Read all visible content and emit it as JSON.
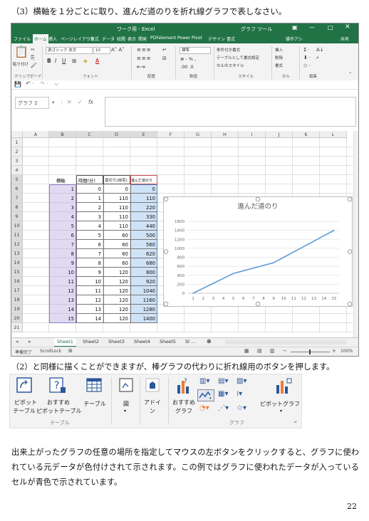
{
  "heading": "（3）横軸を１分ごとに取り、進んだ道のりを折れ線グラフで表しなさい。",
  "excel": {
    "title": "ワーク用 - Excel",
    "chart_tools": "グラフ ツール",
    "tabs": [
      "ファイル",
      "ホーム",
      "挿入",
      "ページレイアウト",
      "数式",
      "データ",
      "校閲",
      "表示",
      "開発",
      "PDFelement",
      "Power Pivot",
      "デザイン",
      "書式"
    ],
    "active_tab": "ホーム",
    "tell_me": "操作アシ",
    "share": "共有",
    "ribbon": {
      "paste": "貼り付け",
      "font_name": "游ゴシック 本文",
      "font_size": "10",
      "number_format": "標準",
      "cond_format": "条件付き書式",
      "table_format": "テーブルとして書式設定",
      "cell_styles": "セルのスタイル",
      "insert": "挿入",
      "delete": "削除",
      "format": "書式",
      "groups": [
        "クリップボード",
        "フォント",
        "配置",
        "数値",
        "スタイル",
        "セル",
        "編集"
      ]
    },
    "name_box": "グラフ 2",
    "fx": "fx",
    "columns": [
      "A",
      "B",
      "C",
      "D",
      "E",
      "F",
      "G",
      "H",
      "I",
      "J",
      "K",
      "L"
    ],
    "rows": [
      "1",
      "2",
      "3",
      "4",
      "5",
      "6",
      "7",
      "8",
      "9",
      "10",
      "11",
      "12",
      "13",
      "14",
      "15",
      "16",
      "17",
      "18",
      "19",
      "20",
      "21"
    ],
    "table_headers": [
      "横軸",
      "時間(分)",
      "道のり(自宅)",
      "進んだ道のり"
    ],
    "table": [
      [
        1,
        0,
        0,
        0
      ],
      [
        2,
        1,
        110,
        110
      ],
      [
        3,
        2,
        110,
        220
      ],
      [
        4,
        3,
        110,
        330
      ],
      [
        5,
        4,
        110,
        440
      ],
      [
        6,
        5,
        60,
        500
      ],
      [
        7,
        6,
        60,
        560
      ],
      [
        8,
        7,
        60,
        620
      ],
      [
        9,
        8,
        60,
        680
      ],
      [
        10,
        9,
        120,
        800
      ],
      [
        11,
        10,
        120,
        920
      ],
      [
        12,
        11,
        120,
        1040
      ],
      [
        13,
        12,
        120,
        1160
      ],
      [
        14,
        13,
        120,
        1280
      ],
      [
        15,
        14,
        120,
        1400
      ]
    ],
    "sheet_tabs": [
      "Sheet1",
      "Sheet2",
      "Sheet3",
      "Sheet4",
      "Sheet5",
      "Sl ..."
    ],
    "active_sheet": "Sheet1",
    "status_left": "準備完了",
    "scroll_lock": "ScrollLock",
    "zoom": "100%"
  },
  "chart_data": {
    "type": "line",
    "title": "進んだ道のり",
    "categories": [
      "1",
      "2",
      "3",
      "4",
      "5",
      "6",
      "7",
      "8",
      "9",
      "10",
      "11",
      "12",
      "13",
      "14",
      "15"
    ],
    "values": [
      0,
      110,
      220,
      330,
      440,
      500,
      560,
      620,
      680,
      800,
      920,
      1040,
      1160,
      1280,
      1400
    ],
    "ylim": [
      0,
      1600
    ],
    "yticks": [
      "0",
      "200",
      "400",
      "600",
      "800",
      "1000",
      "1200",
      "1400",
      "1600"
    ],
    "line_color": "#5b9bd5",
    "grid": true
  },
  "instruction": "（2）と同様に描くことができますが、棒グラフの代わりに折れ線用のボタンを押します。",
  "insert_ribbon": {
    "pivot_table": [
      "ピボット",
      "テーブル"
    ],
    "rec_pivot": [
      "おすすめ",
      "ピボットテーブル"
    ],
    "table": "テーブル",
    "illustrations": "図",
    "addins": [
      "アドイ",
      "ン"
    ],
    "rec_charts": [
      "おすすめ",
      "グラフ"
    ],
    "pivot_chart": "ピボットグラフ",
    "group_table": "テーブル",
    "group_graph": "グラフ"
  },
  "paragraph": "出来上がったグラフの任意の場所を指定してマウスの左ボタンをクリックすると、グラフに使われている元データが色付けされて示されます。この例ではグラフに使われたデータが入っているセルが青色で示されています。",
  "page_number": "22"
}
